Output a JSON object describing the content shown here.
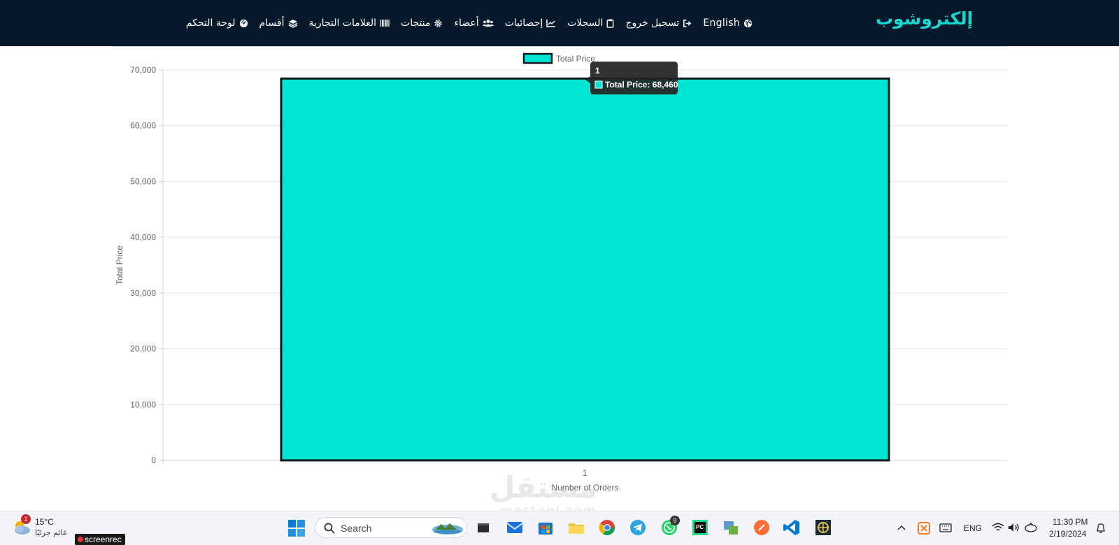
{
  "navbar": {
    "brand": "إلكتروشوب",
    "items": [
      {
        "label": "English",
        "icon": "globe-icon"
      },
      {
        "label": "تسجيل خروج",
        "icon": "sign-out-icon"
      },
      {
        "label": "السجلات",
        "icon": "clipboard-icon"
      },
      {
        "label": "إحصائيات",
        "icon": "chart-line-icon"
      },
      {
        "label": "أعضاء",
        "icon": "users-icon"
      },
      {
        "label": "منتجات",
        "icon": "gear-icon"
      },
      {
        "label": "العلامات التجارية",
        "icon": "barcode-icon"
      },
      {
        "label": "أقسام",
        "icon": "layers-icon"
      },
      {
        "label": "لوحة التحكم",
        "icon": "dashboard-icon"
      }
    ]
  },
  "chart_data": {
    "type": "bar",
    "categories": [
      "1"
    ],
    "series": [
      {
        "name": "Total Price",
        "values": [
          68460
        ]
      }
    ],
    "xlabel": "Number of Orders",
    "ylabel": "Total Price",
    "ylim": [
      0,
      70000
    ],
    "yticks": [
      "0",
      "10,000",
      "20,000",
      "30,000",
      "40,000",
      "50,000",
      "60,000",
      "70,000"
    ],
    "grid": true,
    "legend": "top-center",
    "colors": {
      "fill": "#00e5d1",
      "border": "#0b1a1a"
    },
    "tooltip": {
      "title": "1",
      "text": "Total Price: 68,460"
    }
  },
  "watermark": {
    "text": "مستقل",
    "sub": "mostaql.com"
  },
  "taskbar": {
    "weather": {
      "temp": "15°C",
      "desc": "غائم جزئيًا",
      "badge": "1"
    },
    "screenrec": "screenrec",
    "search_placeholder": "Search",
    "whatsapp_badge": "9",
    "tray": {
      "lang": "ENG",
      "time": "11:30 PM",
      "date": "2/19/2024"
    }
  }
}
